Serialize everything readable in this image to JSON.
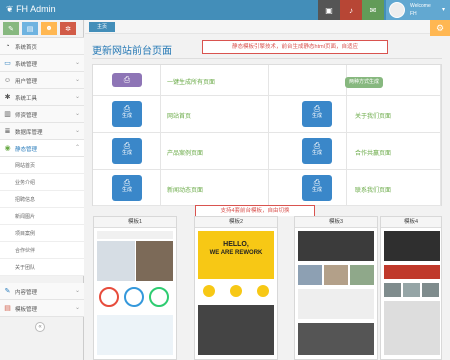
{
  "app": {
    "brand": "FH Admin"
  },
  "user": {
    "welcome": "Welcome",
    "name": "FH"
  },
  "sidebar": {
    "items": [
      {
        "label": "系统首页"
      },
      {
        "label": "系统管理"
      },
      {
        "label": "用户管理"
      },
      {
        "label": "系统工具"
      },
      {
        "label": "师资管理"
      },
      {
        "label": "数据库管理"
      },
      {
        "label": "静态管理"
      }
    ],
    "sub_items": [
      {
        "label": "网站首页"
      },
      {
        "label": "业务介绍"
      },
      {
        "label": "招聘信息"
      },
      {
        "label": "新闻图片"
      },
      {
        "label": "项目案例"
      },
      {
        "label": "合作伙伴"
      },
      {
        "label": "关于团队"
      }
    ],
    "bottom_items": [
      {
        "label": "内容管理"
      },
      {
        "label": "模板管理"
      }
    ]
  },
  "breadcrumb": {
    "current": "主页"
  },
  "main": {
    "title": "更新网站前台页面",
    "callout_top": "静态模板引擎技术，前台生成静态html页面，自适应",
    "callout_templates": "支持4套前台模板，自由切换"
  },
  "grid": {
    "all_label": "一键生成所有页面",
    "all_badge": "两种方式生成",
    "generate": "生成",
    "rows": [
      {
        "left": "网站首页",
        "right": "关于我们页面"
      },
      {
        "left": "产品案例页面",
        "right": "合作共赢页面"
      },
      {
        "left": "新闻动态页面",
        "right": "联系我们页面"
      }
    ]
  },
  "templates": {
    "items": [
      {
        "name": "模板1"
      },
      {
        "name": "模板2",
        "hero_line1": "HELLO,",
        "hero_line2": "WE ARE REWORK"
      },
      {
        "name": "模板3"
      },
      {
        "name": "模板4"
      }
    ]
  },
  "colors": {
    "topbar": "#438eb9",
    "accent_blue": "#3a87c9",
    "accent_green": "#87b87f",
    "accent_red": "#d9534f"
  }
}
